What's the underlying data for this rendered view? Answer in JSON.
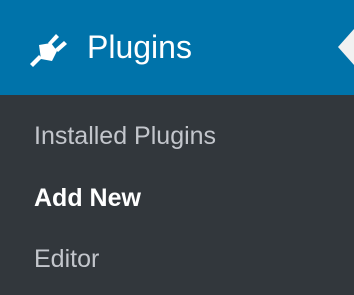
{
  "menu": {
    "title": "Plugins",
    "icon": "plugin-icon",
    "colors": {
      "header_bg": "#0073aa",
      "submenu_bg": "#32373c",
      "pointer": "#f1f1f1",
      "active_text": "#ffffff",
      "inactive_text": "#c3c6cc"
    },
    "submenu": [
      {
        "label": "Installed Plugins",
        "active": false
      },
      {
        "label": "Add New",
        "active": true
      },
      {
        "label": "Editor",
        "active": false
      }
    ]
  }
}
